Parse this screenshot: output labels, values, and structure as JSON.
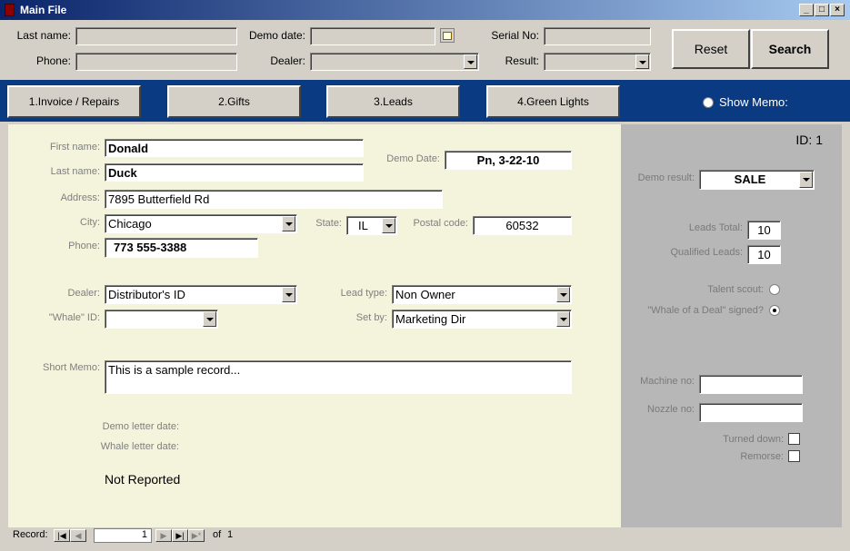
{
  "window": {
    "title": "Main File"
  },
  "search": {
    "last_name_label": "Last name:",
    "phone_label": "Phone:",
    "demo_date_label": "Demo date:",
    "dealer_label": "Dealer:",
    "serial_label": "Serial No:",
    "result_label": "Result:",
    "reset_label": "Reset",
    "search_label": "Search"
  },
  "tabs": [
    {
      "label": "1.Invoice / Repairs"
    },
    {
      "label": "2.Gifts"
    },
    {
      "label": "3.Leads"
    },
    {
      "label": "4.Green Lights"
    }
  ],
  "show_memo_label": "Show Memo:",
  "record": {
    "first_name_label": "First name:",
    "first_name": "Donald",
    "last_name_label": "Last name:",
    "last_name": "Duck",
    "demo_date_label": "Demo Date:",
    "demo_date": "Pn, 3-22-10",
    "address_label": "Address:",
    "address": "7895 Butterfield Rd",
    "city_label": "City:",
    "city": "Chicago",
    "state_label": "State:",
    "state": "IL",
    "postal_label": "Postal code:",
    "postal": "60532",
    "phone_label": "Phone:",
    "phone": "773 555-3388",
    "dealer_label": "Dealer:",
    "dealer": "Distributor's ID",
    "lead_type_label": "Lead type:",
    "lead_type": "Non Owner",
    "whale_id_label": "\"Whale\" ID:",
    "whale_id": "",
    "set_by_label": "Set by:",
    "set_by": "Marketing Dir",
    "short_memo_label": "Short Memo:",
    "short_memo": "This is a sample record...",
    "demo_letter_label": "Demo letter date:",
    "whale_letter_label": "Whale letter date:",
    "status_text": "Not Reported"
  },
  "side": {
    "id_text": "ID: 1",
    "demo_result_label": "Demo result:",
    "demo_result": "SALE",
    "leads_total_label": "Leads Total:",
    "leads_total": "10",
    "qualified_label": "Qualified Leads:",
    "qualified": "10",
    "talent_scout_label": "Talent scout:",
    "whale_signed_label": "\"Whale of a Deal\" signed?",
    "machine_label": "Machine no:",
    "nozzle_label": "Nozzle no:",
    "turned_down_label": "Turned down:",
    "remorse_label": "Remorse:"
  },
  "nav": {
    "record_label": "Record:",
    "current": "1",
    "of_label": "of",
    "total": "1"
  }
}
